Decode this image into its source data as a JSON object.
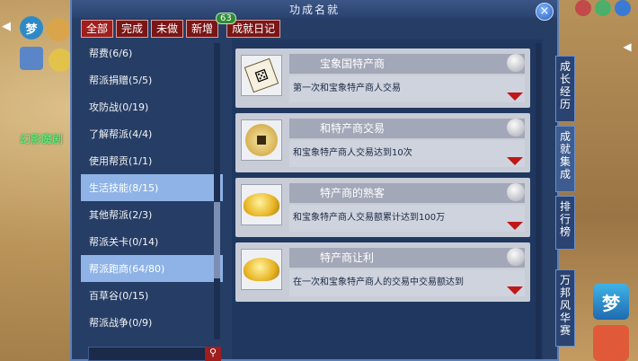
{
  "window": {
    "title": "功成名就",
    "close_label": "×"
  },
  "world": {
    "label": "幻影魔剧"
  },
  "hud": {
    "icon_left_label": "梦",
    "icon_right_label": "梦"
  },
  "tabs": [
    {
      "label": "全部",
      "active": true
    },
    {
      "label": "完成",
      "active": false
    },
    {
      "label": "未做",
      "active": false
    },
    {
      "label": "新增",
      "active": false
    },
    {
      "label": "成就日记",
      "active": false
    }
  ],
  "new_badge": "63",
  "categories": [
    {
      "label": "帮费(6/6)"
    },
    {
      "label": "帮派捐赠(5/5)"
    },
    {
      "label": "攻防战(0/19)"
    },
    {
      "label": "了解帮派(4/4)"
    },
    {
      "label": "使用帮贡(1/1)"
    },
    {
      "label": "生活技能(8/15)",
      "selected": true
    },
    {
      "label": "其他帮派(2/3)"
    },
    {
      "label": "帮派关卡(0/14)"
    },
    {
      "label": "帮派跑商(64/80)",
      "selected": true
    },
    {
      "label": "百草谷(0/15)"
    },
    {
      "label": "帮派战争(0/9)"
    }
  ],
  "achievements": [
    {
      "title": "宝象国特产商",
      "desc": "第一次和宝象特产商人交易",
      "icon": "dice-icon"
    },
    {
      "title": "和特产商交易",
      "desc": "和宝象特产商人交易达到10次",
      "icon": "coin-icon"
    },
    {
      "title": "特产商的熟客",
      "desc": "和宝象特产商人交易额累计达到100万",
      "icon": "gold-ingot-icon"
    },
    {
      "title": "特产商让利",
      "desc": "在一次和宝象特产商人的交易中交易额达到",
      "icon": "gold-ingot-icon"
    }
  ],
  "side_tabs": [
    {
      "label": "成长经历"
    },
    {
      "label": "成就集成",
      "active": true
    },
    {
      "label": "排行榜"
    },
    {
      "label": "万邦风华赛"
    }
  ],
  "colors": {
    "window_bg": "#263e66",
    "tab_red": "#7a1616",
    "selected_blue": "#8fb3e6"
  }
}
